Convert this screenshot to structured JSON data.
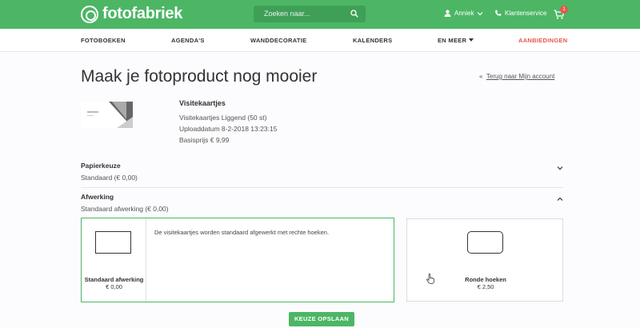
{
  "header": {
    "brand": "fotofabriek",
    "search_placeholder": "Zoeken naar...",
    "user_name": "Anniek",
    "service_label": "Klantenservice",
    "cart_count": "1",
    "brand_color": "#4cb665",
    "badge_color": "#e5574c"
  },
  "nav": {
    "items": [
      "FOTOBOEKEN",
      "AGENDA'S",
      "WANDDECORATIE",
      "KALENDERS",
      "EN MEER",
      "AANBIEDINGEN"
    ]
  },
  "page": {
    "title": "Maak je fotoproduct nog mooier",
    "back_prefix": "«",
    "back_link": "Terug naar Mijn account"
  },
  "product": {
    "name": "Visitekaartjes",
    "variant": "Visitekaartjes Liggend (50 st)",
    "upload_date": "Uploaddatum 8-2-2018 13:23:15",
    "base_price": "Basisprijs € 9,99"
  },
  "sections": {
    "paper": {
      "title": "Papierkeuze",
      "value": "Standaard (€ 0,00)"
    },
    "finish": {
      "title": "Afwerking",
      "value": "Standaard afwerking (€ 0,00)"
    }
  },
  "options": {
    "standard": {
      "label": "Standaard afwerking",
      "price": "€ 0,00",
      "description": "De visitekaartjes worden standaard afgewerkt met rechte hoeken."
    },
    "rounded": {
      "label": "Ronde hoeken",
      "price": "€ 2,50"
    }
  },
  "actions": {
    "save_label": "KEUZE OPSLAAN"
  }
}
